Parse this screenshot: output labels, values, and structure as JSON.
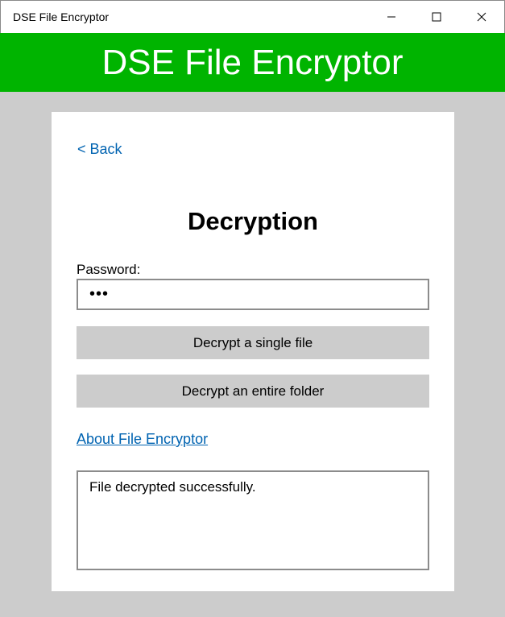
{
  "window": {
    "title": "DSE File Encryptor",
    "controls": [
      "minimize-icon",
      "maximize-icon",
      "close-icon"
    ]
  },
  "banner": {
    "title": "DSE File Encryptor",
    "color": "#00b400"
  },
  "page": {
    "back_label": "< Back",
    "heading": "Decryption",
    "password_label": "Password:",
    "password_value": "•••",
    "buttons": {
      "single_file": "Decrypt a single file",
      "entire_folder": "Decrypt an entire folder"
    },
    "about_link": "About File Encryptor",
    "status_text": "File decrypted successfully."
  },
  "colors": {
    "background": "#cccccc",
    "link": "#0063b1",
    "button": "#cccccc"
  }
}
